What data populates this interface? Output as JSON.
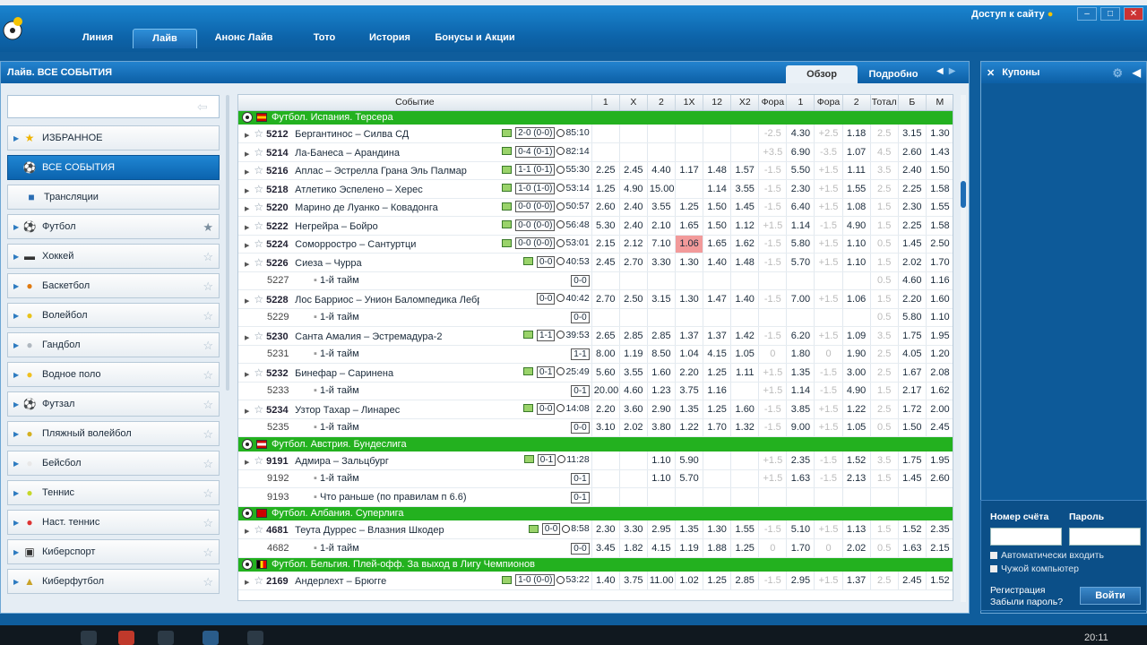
{
  "nav": {
    "tabs": [
      "Линия",
      "Лайв",
      "Анонс Лайв",
      "Тото",
      "История",
      "Бонусы и Акции"
    ],
    "active": "Лайв",
    "access_label": "Доступ к сайту"
  },
  "main": {
    "title": "Лайв. ВСЕ СОБЫТИЯ",
    "view_tabs": [
      "Обзор",
      "Подробно"
    ]
  },
  "sidebar": {
    "items": [
      {
        "label": "ИЗБРАННОЕ",
        "icon": "star-icon",
        "type": "fav"
      },
      {
        "label": "ВСЕ СОБЫТИЯ",
        "icon": "ball-icon",
        "type": "active"
      },
      {
        "label": "Трансляции",
        "icon": "tv-icon",
        "type": "translations"
      },
      {
        "label": "Футбол",
        "icon": "football-icon",
        "starred": true
      },
      {
        "label": "Хоккей",
        "icon": "hockey-icon"
      },
      {
        "label": "Баскетбол",
        "icon": "basketball-icon"
      },
      {
        "label": "Волейбол",
        "icon": "volleyball-icon"
      },
      {
        "label": "Гандбол",
        "icon": "handball-icon"
      },
      {
        "label": "Водное поло",
        "icon": "waterpolo-icon"
      },
      {
        "label": "Футзал",
        "icon": "futsal-icon"
      },
      {
        "label": "Пляжный волейбол",
        "icon": "beach-volleyball-icon"
      },
      {
        "label": "Бейсбол",
        "icon": "baseball-icon"
      },
      {
        "label": "Теннис",
        "icon": "tennis-icon"
      },
      {
        "label": "Наст. теннис",
        "icon": "table-tennis-icon"
      },
      {
        "label": "Киберспорт",
        "icon": "gamepad-icon"
      },
      {
        "label": "Киберфутбол",
        "icon": "cup-icon"
      }
    ]
  },
  "table": {
    "headers": [
      "Событие",
      "1",
      "X",
      "2",
      "1X",
      "12",
      "X2",
      "Фора",
      "1",
      "Фора",
      "2",
      "Тотал",
      "Б",
      "М"
    ],
    "rows": [
      {
        "type": "league",
        "label": "Футбол. Испания. Терсера",
        "flag": "es"
      },
      {
        "type": "match",
        "num": "5212",
        "name": "Бергантинос – Силва СД",
        "score": "2-0 (0-0)",
        "time": "85:10",
        "tv": true,
        "odds": [
          "",
          "",
          "",
          "",
          "",
          "",
          "-2.5",
          "4.30",
          "+2.5",
          "1.18",
          "2.5",
          "3.15",
          "1.30"
        ]
      },
      {
        "type": "match",
        "num": "5214",
        "name": "Ла-Банеса – Арандина",
        "score": "0-4 (0-1)",
        "time": "82:14",
        "tv": true,
        "odds": [
          "",
          "",
          "",
          "",
          "",
          "",
          "+3.5",
          "6.90",
          "-3.5",
          "1.07",
          "4.5",
          "2.60",
          "1.43"
        ]
      },
      {
        "type": "match",
        "num": "5216",
        "name": "Аплас – Эстрелла Грана Эль Палмар",
        "score": "1-1 (0-1)",
        "time": "55:30",
        "tv": true,
        "odds": [
          "2.25",
          "2.45",
          "4.40",
          "1.17",
          "1.48",
          "1.57",
          "-1.5",
          "5.50",
          "+1.5",
          "1.11",
          "3.5",
          "2.40",
          "1.50"
        ]
      },
      {
        "type": "match",
        "num": "5218",
        "name": "Атлетико Эспелено – Херес",
        "score": "1-0 (1-0)",
        "time": "53:14",
        "tv": true,
        "odds": [
          "1.25",
          "4.90",
          "15.00",
          "",
          "1.14",
          "3.55",
          "-1.5",
          "2.30",
          "+1.5",
          "1.55",
          "2.5",
          "2.25",
          "1.58"
        ]
      },
      {
        "type": "match",
        "num": "5220",
        "name": "Марино де Луанко – Ковадонга",
        "score": "0-0 (0-0)",
        "time": "50:57",
        "tv": true,
        "odds": [
          "2.60",
          "2.40",
          "3.55",
          "1.25",
          "1.50",
          "1.45",
          "-1.5",
          "6.40",
          "+1.5",
          "1.08",
          "1.5",
          "2.30",
          "1.55"
        ]
      },
      {
        "type": "match",
        "num": "5222",
        "name": "Негрейра – Бойро",
        "score": "0-0 (0-0)",
        "time": "56:48",
        "tv": true,
        "odds": [
          "5.30",
          "2.40",
          "2.10",
          "1.65",
          "1.50",
          "1.12",
          "+1.5",
          "1.14",
          "-1.5",
          "4.90",
          "1.5",
          "2.25",
          "1.58"
        ]
      },
      {
        "type": "match",
        "num": "5224",
        "name": "Соморростро – Сантуртци",
        "score": "0-0 (0-0)",
        "time": "53:01",
        "tv": true,
        "highlight": 3,
        "odds": [
          "2.15",
          "2.12",
          "7.10",
          "1.06",
          "1.65",
          "1.62",
          "-1.5",
          "5.80",
          "+1.5",
          "1.10",
          "0.5",
          "1.45",
          "2.50"
        ]
      },
      {
        "type": "match",
        "num": "5226",
        "name": "Сиеза – Чурра",
        "score": "0-0",
        "time": "40:53",
        "tv": true,
        "odds": [
          "2.45",
          "2.70",
          "3.30",
          "1.30",
          "1.40",
          "1.48",
          "-1.5",
          "5.70",
          "+1.5",
          "1.10",
          "1.5",
          "2.02",
          "1.70"
        ]
      },
      {
        "type": "sub",
        "num": "5227",
        "name": "1-й тайм",
        "score": "0-0",
        "odds": [
          "",
          "",
          "",
          "",
          "",
          "",
          "",
          "",
          "",
          "",
          "0.5",
          "4.60",
          "1.16"
        ]
      },
      {
        "type": "match",
        "num": "5228",
        "name": "Лос Барриос – Унион Баломпедика Лебр.",
        "score": "0-0",
        "time": "40:42",
        "odds": [
          "2.70",
          "2.50",
          "3.15",
          "1.30",
          "1.47",
          "1.40",
          "-1.5",
          "7.00",
          "+1.5",
          "1.06",
          "1.5",
          "2.20",
          "1.60"
        ]
      },
      {
        "type": "sub",
        "num": "5229",
        "name": "1-й тайм",
        "score": "0-0",
        "odds": [
          "",
          "",
          "",
          "",
          "",
          "",
          "",
          "",
          "",
          "",
          "0.5",
          "5.80",
          "1.10"
        ]
      },
      {
        "type": "match",
        "num": "5230",
        "name": "Санта Амалия – Эстремадура-2",
        "score": "1-1",
        "time": "39:53",
        "tv": true,
        "odds": [
          "2.65",
          "2.85",
          "2.85",
          "1.37",
          "1.37",
          "1.42",
          "-1.5",
          "6.20",
          "+1.5",
          "1.09",
          "3.5",
          "1.75",
          "1.95"
        ]
      },
      {
        "type": "sub",
        "num": "5231",
        "name": "1-й тайм",
        "score": "1-1",
        "odds": [
          "8.00",
          "1.19",
          "8.50",
          "1.04",
          "4.15",
          "1.05",
          "0",
          "1.80",
          "0",
          "1.90",
          "2.5",
          "4.05",
          "1.20"
        ]
      },
      {
        "type": "match",
        "num": "5232",
        "name": "Бинефар – Саринена",
        "score": "0-1",
        "time": "25:49",
        "tv": true,
        "odds": [
          "5.60",
          "3.55",
          "1.60",
          "2.20",
          "1.25",
          "1.11",
          "+1.5",
          "1.35",
          "-1.5",
          "3.00",
          "2.5",
          "1.67",
          "2.08"
        ]
      },
      {
        "type": "sub",
        "num": "5233",
        "name": "1-й тайм",
        "score": "0-1",
        "odds": [
          "20.00",
          "4.60",
          "1.23",
          "3.75",
          "1.16",
          "",
          "+1.5",
          "1.14",
          "-1.5",
          "4.90",
          "1.5",
          "2.17",
          "1.62"
        ]
      },
      {
        "type": "match",
        "num": "5234",
        "name": "Узтор Тахар – Линарес",
        "score": "0-0",
        "time": "14:08",
        "tv": true,
        "odds": [
          "2.20",
          "3.60",
          "2.90",
          "1.35",
          "1.25",
          "1.60",
          "-1.5",
          "3.85",
          "+1.5",
          "1.22",
          "2.5",
          "1.72",
          "2.00"
        ]
      },
      {
        "type": "sub",
        "num": "5235",
        "name": "1-й тайм",
        "score": "0-0",
        "odds": [
          "3.10",
          "2.02",
          "3.80",
          "1.22",
          "1.70",
          "1.32",
          "-1.5",
          "9.00",
          "+1.5",
          "1.05",
          "0.5",
          "1.50",
          "2.45"
        ]
      },
      {
        "type": "league",
        "label": "Футбол. Австрия. Бундеслига",
        "flag": "at"
      },
      {
        "type": "match",
        "num": "9191",
        "name": "Адмира – Зальцбург",
        "score": "0-1",
        "time": "11:28",
        "tv": true,
        "odds": [
          "",
          "",
          "1.10",
          "5.90",
          "",
          "",
          "+1.5",
          "2.35",
          "-1.5",
          "1.52",
          "3.5",
          "1.75",
          "1.95"
        ]
      },
      {
        "type": "sub",
        "num": "9192",
        "name": "1-й тайм",
        "score": "0-1",
        "odds": [
          "",
          "",
          "1.10",
          "5.70",
          "",
          "",
          "+1.5",
          "1.63",
          "-1.5",
          "2.13",
          "1.5",
          "1.45",
          "2.60"
        ]
      },
      {
        "type": "sub",
        "num": "9193",
        "name": "Что раньше (по правилам п 6.6)",
        "score": "0-1",
        "odds": [
          "",
          "",
          "",
          "",
          "",
          "",
          "",
          "",
          "",
          "",
          "",
          "",
          ""
        ]
      },
      {
        "type": "league",
        "label": "Футбол. Албания. Суперлига",
        "flag": "al"
      },
      {
        "type": "match",
        "num": "4681",
        "name": "Теута Дуррес – Влазния Шкодер",
        "score": "0-0",
        "time": "8:58",
        "tv": true,
        "odds": [
          "2.30",
          "3.30",
          "2.95",
          "1.35",
          "1.30",
          "1.55",
          "-1.5",
          "5.10",
          "+1.5",
          "1.13",
          "1.5",
          "1.52",
          "2.35"
        ]
      },
      {
        "type": "sub",
        "num": "4682",
        "name": "1-й тайм",
        "score": "0-0",
        "odds": [
          "3.45",
          "1.82",
          "4.15",
          "1.19",
          "1.88",
          "1.25",
          "0",
          "1.70",
          "0",
          "2.02",
          "0.5",
          "1.63",
          "2.15"
        ]
      },
      {
        "type": "league",
        "label": "Футбол. Бельгия. Плей-офф. За выход в Лигу Чемпионов",
        "flag": "be"
      },
      {
        "type": "match",
        "num": "2169",
        "name": "Андерлехт – Брюгге",
        "score": "1-0 (0-0)",
        "time": "53:22",
        "tv": true,
        "odds": [
          "1.40",
          "3.75",
          "11.00",
          "1.02",
          "1.25",
          "2.85",
          "-1.5",
          "2.95",
          "+1.5",
          "1.37",
          "2.5",
          "2.45",
          "1.52"
        ]
      }
    ]
  },
  "coupons": {
    "title": "Купоны"
  },
  "login": {
    "account_label": "Номер счёта",
    "password_label": "Пароль",
    "auto_login": "Автоматически входить",
    "foreign_pc": "Чужой компьютер",
    "register": "Регистрация",
    "forgot": "Забыли пароль?",
    "login_button": "Войти"
  },
  "taskbar": {
    "clock": "20:11"
  },
  "colors": {
    "league_bar": "#23b11f",
    "header_blue": "#0c5fa5",
    "highlight_cell": "#f29a9a"
  }
}
